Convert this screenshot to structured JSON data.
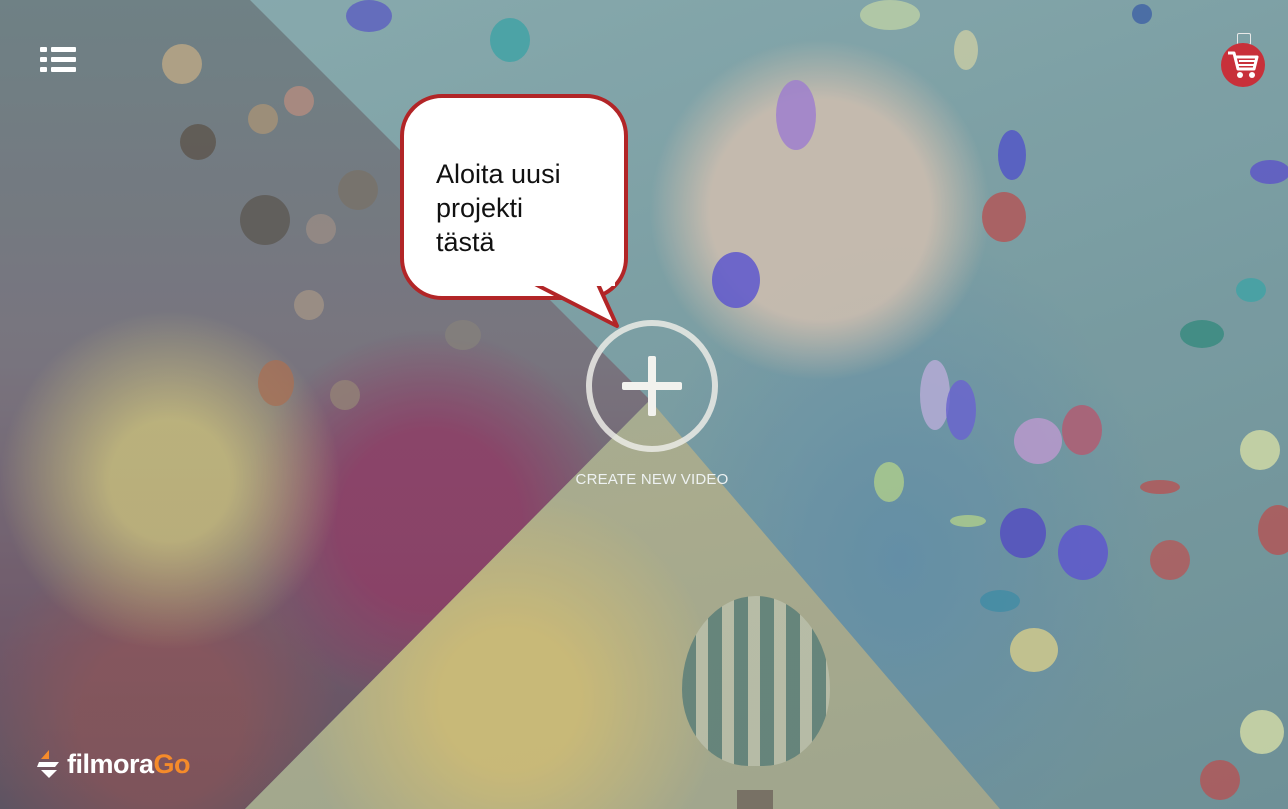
{
  "app": {
    "name": "FilmoraGo"
  },
  "header": {
    "menu_icon": "list-menu-icon",
    "cart_icon": "shopping-cart-icon"
  },
  "callout": {
    "text": "Aloita uusi\nprojekti\ntästä"
  },
  "create": {
    "icon": "plus-icon",
    "label": "CREATE NEW VIDEO"
  },
  "logo": {
    "part1": "filmora",
    "part2": "Go"
  },
  "colors": {
    "callout_border": "#b22527",
    "cart_bg": "#c8303a",
    "logo_accent": "#f58b2a"
  }
}
